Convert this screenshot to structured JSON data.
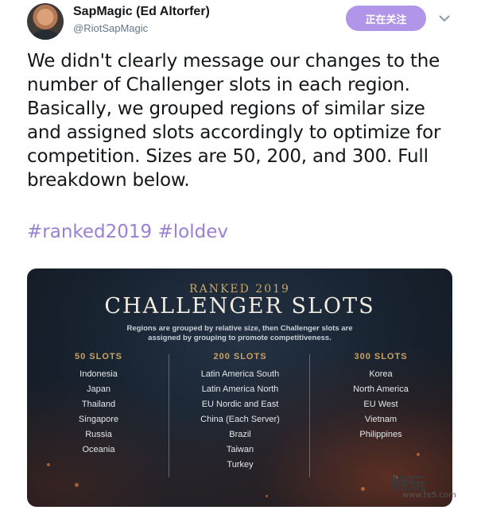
{
  "tweet": {
    "display_name": "SapMagic (Ed Altorfer)",
    "handle": "@RiotSapMagic",
    "follow_label": "正在关注",
    "text_lines": [
      "We didn't clearly message our changes to the",
      "number of Challenger slots in each region.",
      "Basically, we grouped regions of similar size",
      "and assigned slots accordingly to optimize for",
      "competition. Sizes are 50, 200, and 300. Full",
      "breakdown below."
    ],
    "hashtags": [
      "#ranked2019",
      "#loldev"
    ]
  },
  "card": {
    "subtitle": "RANKED 2019",
    "title": "CHALLENGER SLOTS",
    "desc_lines": [
      "Regions are grouped by relative size, then Challenger slots are",
      "assigned by grouping to promote competitiveness."
    ],
    "columns": [
      {
        "heading": "50 SLOTS",
        "regions": [
          "Indonesia",
          "Japan",
          "Thailand",
          "Singapore",
          "Russia",
          "Oceania"
        ]
      },
      {
        "heading": "200 SLOTS",
        "regions": [
          "Latin America South",
          "Latin America North",
          "EU Nordic and East",
          "China (Each Server)",
          "Brazil",
          "Taiwan",
          "Turkey"
        ]
      },
      {
        "heading": "300 SLOTS",
        "regions": [
          "Korea",
          "North America",
          "EU West",
          "Vietnam",
          "Philippines"
        ]
      }
    ]
  },
  "watermark": {
    "main": "特玩",
    "sub": "www.te5.com"
  },
  "colors": {
    "follow_button": "#b095e8",
    "hashtag": "#9b7fd4",
    "card_heading": "#c8a164"
  },
  "icons": [
    "chevron-down-icon"
  ]
}
